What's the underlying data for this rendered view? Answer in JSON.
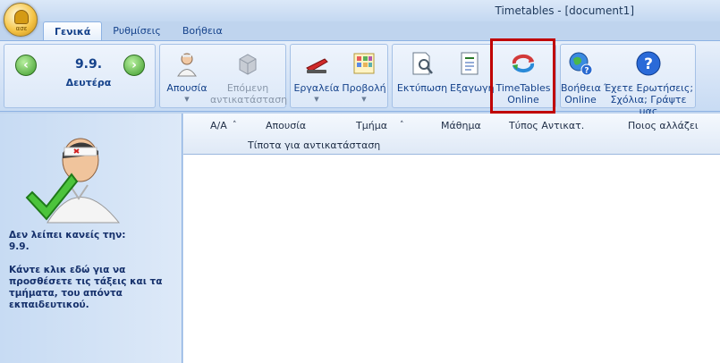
{
  "window": {
    "title": "Timetables - [document1]"
  },
  "app_orb": {
    "label": "ασε"
  },
  "tabs": [
    {
      "label": "Γενικά",
      "active": true
    },
    {
      "label": "Ρυθμίσεις",
      "active": false
    },
    {
      "label": "Βοήθεια",
      "active": false
    }
  ],
  "date_nav": {
    "date": "9.9.",
    "day": "Δευτέρα"
  },
  "ribbon": {
    "absence": "Απουσία",
    "next_replacement": "Επόμενη αντικατάσταση",
    "tools": "Εργαλεία",
    "view": "Προβολή",
    "print": "Εκτύπωση",
    "export": "Εξαγωγή",
    "timetables_online_1": "TimeTables",
    "timetables_online_2": "Online",
    "help_online_1": "Βοήθεια",
    "help_online_2": "Online",
    "questions_1": "Έχετε Ερωτήσεις;",
    "questions_2": "Σχόλια; Γράψτε μας"
  },
  "grid": {
    "columns": [
      "Α/Α",
      "Απουσία",
      "Τμήμα",
      "Μάθημα",
      "Τύπος Αντικατ.",
      "Ποιος αλλάζει"
    ],
    "sort_glyph": "˄",
    "empty_text": "Τίποτα για αντικατάσταση"
  },
  "left_pane": {
    "message": "Δεν λείπει κανείς την:\n9.9.\n\nΚάντε κλικ εδώ για να προσθέσετε τις τάξεις και τα τμήματα, του απόντα εκπαιδευτικού."
  },
  "colors": {
    "accent": "#15428b",
    "highlight": "#c00000",
    "ribbon_bg": "#d3e2f6"
  }
}
